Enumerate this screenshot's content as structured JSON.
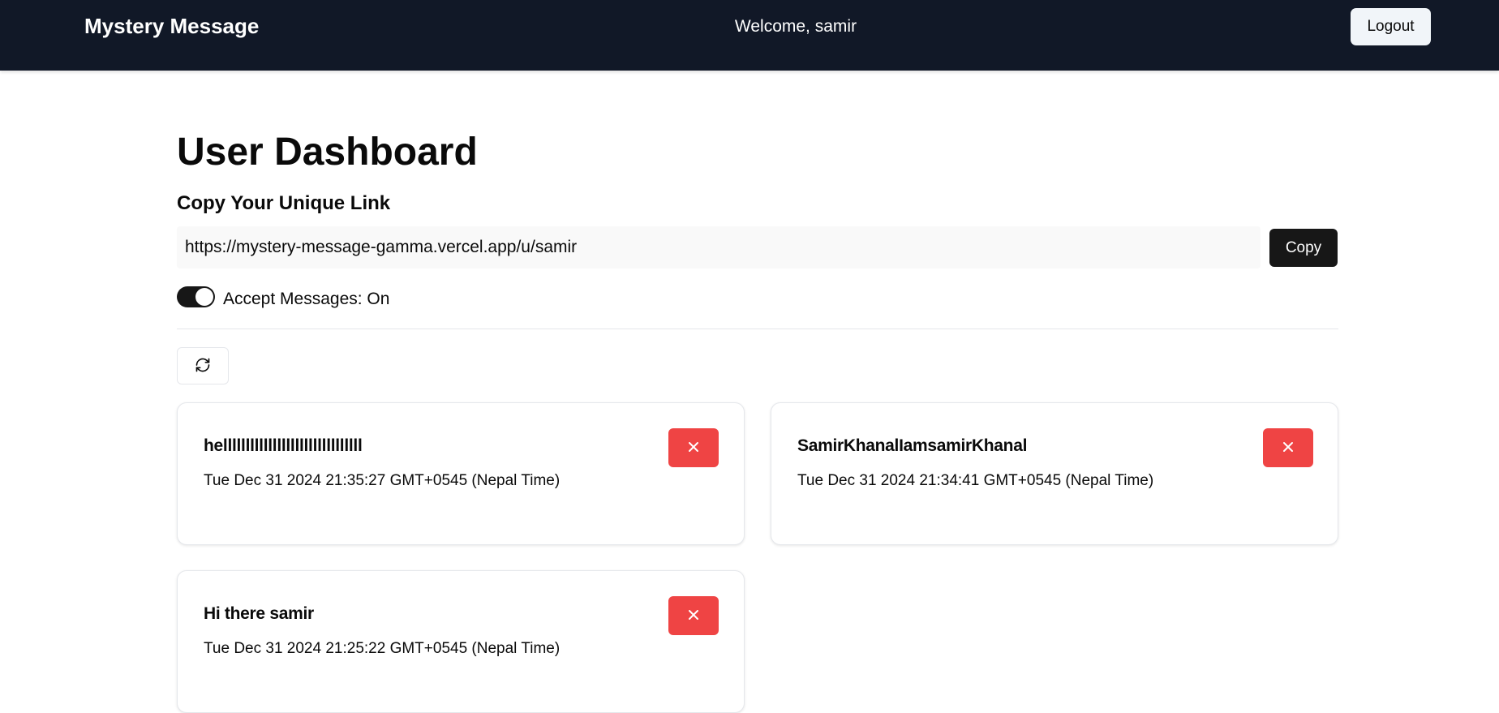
{
  "header": {
    "brand": "Mystery Message",
    "welcome": "Welcome, samir",
    "logout_label": "Logout"
  },
  "dashboard": {
    "title": "User Dashboard",
    "link_section_title": "Copy Your Unique Link",
    "unique_link": "https://mystery-message-gamma.vercel.app/u/samir",
    "copy_label": "Copy",
    "accept_messages": {
      "label": "Accept Messages: On",
      "enabled": true
    },
    "refresh_icon": "refresh-icon"
  },
  "messages": [
    {
      "content": "helllllllllllllllllllllllllllllll",
      "date": "Tue Dec 31 2024 21:35:27 GMT+0545 (Nepal Time)"
    },
    {
      "content": "SamirKhanalIamsamirKhanal",
      "date": "Tue Dec 31 2024 21:34:41 GMT+0545 (Nepal Time)"
    },
    {
      "content": "Hi there samir",
      "date": "Tue Dec 31 2024 21:25:22 GMT+0545 (Nepal Time)"
    }
  ],
  "colors": {
    "navbar": "#111827",
    "delete": "#ef4444",
    "primary": "#171717"
  }
}
